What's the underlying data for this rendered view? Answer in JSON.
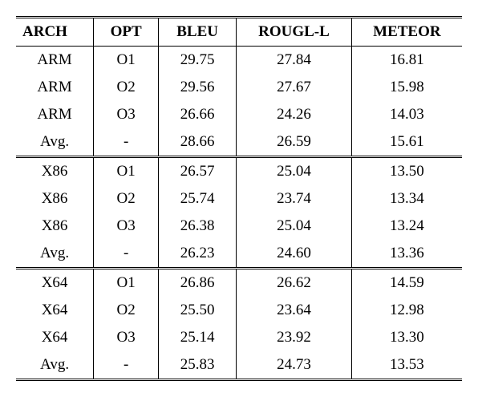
{
  "headers": [
    "ARCH",
    "OPT",
    "BLEU",
    "ROUGL-L",
    "METEOR"
  ],
  "groups": [
    {
      "rows": [
        {
          "arch": "ARM",
          "opt": "O1",
          "bleu": "29.75",
          "rougl": "27.84",
          "meteor": "16.81"
        },
        {
          "arch": "ARM",
          "opt": "O2",
          "bleu": "29.56",
          "rougl": "27.67",
          "meteor": "15.98"
        },
        {
          "arch": "ARM",
          "opt": "O3",
          "bleu": "26.66",
          "rougl": "24.26",
          "meteor": "14.03"
        },
        {
          "arch": "Avg.",
          "opt": "-",
          "bleu": "28.66",
          "rougl": "26.59",
          "meteor": "15.61"
        }
      ]
    },
    {
      "rows": [
        {
          "arch": "X86",
          "opt": "O1",
          "bleu": "26.57",
          "rougl": "25.04",
          "meteor": "13.50"
        },
        {
          "arch": "X86",
          "opt": "O2",
          "bleu": "25.74",
          "rougl": "23.74",
          "meteor": "13.34"
        },
        {
          "arch": "X86",
          "opt": "O3",
          "bleu": "26.38",
          "rougl": "25.04",
          "meteor": "13.24"
        },
        {
          "arch": "Avg.",
          "opt": "-",
          "bleu": "26.23",
          "rougl": "24.60",
          "meteor": "13.36"
        }
      ]
    },
    {
      "rows": [
        {
          "arch": "X64",
          "opt": "O1",
          "bleu": "26.86",
          "rougl": "26.62",
          "meteor": "14.59"
        },
        {
          "arch": "X64",
          "opt": "O2",
          "bleu": "25.50",
          "rougl": "23.64",
          "meteor": "12.98"
        },
        {
          "arch": "X64",
          "opt": "O3",
          "bleu": "25.14",
          "rougl": "23.92",
          "meteor": "13.30"
        },
        {
          "arch": "Avg.",
          "opt": "-",
          "bleu": "25.83",
          "rougl": "24.73",
          "meteor": "13.53"
        }
      ]
    }
  ]
}
